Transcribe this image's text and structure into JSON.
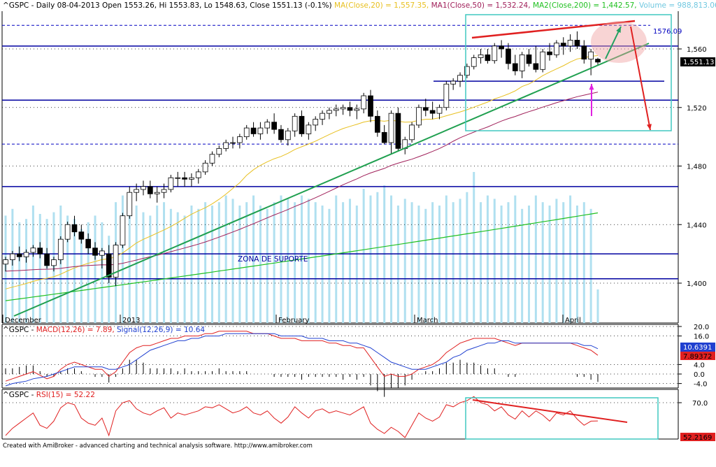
{
  "header": {
    "main_prefix": "^GSPC - Daily 08-04-2013 Open 1553.26, Hi 1553.83, Lo 1548.63, Close 1551.13 (-0.1%)",
    "ma20": "MA(Close,20) = 1,557.35,",
    "ma50": "MA1(Close,50) = 1,532.24,",
    "ma200": "MA2(Close,200) = 1,442.57,",
    "volume": "Volume = 988,813.06",
    "macd_prefix": "^GSPC - ",
    "macd_label": "MACD(12,26) = 7.89,",
    "signal_label": "Signal(12,26,9) = 10.64",
    "rsi_prefix": "^GSPC - ",
    "rsi_label": "RSI(15) = 52.22"
  },
  "annotations": {
    "support_zone": "ZONA DE SUPORTE",
    "level_1576": "1576.09",
    "last_close_tag": "1,551.13",
    "macd_tag": "10.6391",
    "signal_tag": "7.89372",
    "rsi_tag": "52.2169"
  },
  "footer": "Created with AmiBroker - advanced charting and technical analysis software. http://www.amibroker.com",
  "colors": {
    "ma20": "#e8c020",
    "ma50": "#a0205a",
    "ma200": "#20c020",
    "trendline": "#20a050",
    "resistance": "#e02020",
    "hlines": "#0000a0",
    "volume": "#b0e0f0",
    "macd": "#e02020",
    "signal": "#2040d0",
    "rsi": "#e02020",
    "box": "#40c8c0"
  },
  "chart_data": [
    {
      "type": "candlestick",
      "x_labels": [
        "December",
        "2013",
        "February",
        "March",
        "April"
      ],
      "y_ticks": [
        1400,
        1440,
        1480,
        1520,
        1560
      ],
      "y_tick_labels": [
        "1,400",
        "1,440",
        "1,480",
        "1,520",
        "1,560"
      ],
      "ylim": [
        1380,
        1591
      ],
      "horizontal_levels": [
        1576.09,
        1562,
        1538,
        1525,
        1495,
        1466,
        1420,
        1403
      ],
      "candles": [
        [
          1413,
          1418,
          1408,
          1416
        ],
        [
          1416,
          1422,
          1412,
          1420
        ],
        [
          1420,
          1425,
          1415,
          1418
        ],
        [
          1418,
          1423,
          1414,
          1421
        ],
        [
          1421,
          1426,
          1418,
          1424
        ],
        [
          1424,
          1428,
          1417,
          1420
        ],
        [
          1420,
          1424,
          1410,
          1412
        ],
        [
          1412,
          1418,
          1408,
          1416
        ],
        [
          1416,
          1432,
          1413,
          1430
        ],
        [
          1430,
          1442,
          1428,
          1440
        ],
        [
          1440,
          1446,
          1432,
          1435
        ],
        [
          1435,
          1440,
          1427,
          1430
        ],
        [
          1430,
          1434,
          1420,
          1424
        ],
        [
          1424,
          1428,
          1416,
          1419
        ],
        [
          1419,
          1424,
          1410,
          1422
        ],
        [
          1420,
          1426,
          1400,
          1404
        ],
        [
          1404,
          1428,
          1398,
          1426
        ],
        [
          1426,
          1448,
          1424,
          1446
        ],
        [
          1446,
          1466,
          1444,
          1462
        ],
        [
          1462,
          1468,
          1456,
          1464
        ],
        [
          1464,
          1470,
          1460,
          1466
        ],
        [
          1466,
          1470,
          1458,
          1461
        ],
        [
          1461,
          1466,
          1455,
          1462
        ],
        [
          1462,
          1468,
          1458,
          1464
        ],
        [
          1464,
          1474,
          1462,
          1472
        ],
        [
          1472,
          1476,
          1466,
          1472
        ],
        [
          1472,
          1476,
          1466,
          1471
        ],
        [
          1471,
          1475,
          1466,
          1472
        ],
        [
          1472,
          1478,
          1468,
          1476
        ],
        [
          1476,
          1484,
          1474,
          1482
        ],
        [
          1482,
          1490,
          1480,
          1488
        ],
        [
          1488,
          1494,
          1486,
          1492
        ],
        [
          1492,
          1498,
          1490,
          1496
        ],
        [
          1496,
          1500,
          1492,
          1496
        ],
        [
          1496,
          1502,
          1492,
          1500
        ],
        [
          1500,
          1508,
          1498,
          1506
        ],
        [
          1506,
          1510,
          1500,
          1502
        ],
        [
          1502,
          1510,
          1498,
          1506
        ],
        [
          1506,
          1512,
          1502,
          1510
        ],
        [
          1510,
          1516,
          1502,
          1505
        ],
        [
          1505,
          1508,
          1496,
          1498
        ],
        [
          1498,
          1506,
          1494,
          1504
        ],
        [
          1504,
          1516,
          1500,
          1514
        ],
        [
          1514,
          1518,
          1500,
          1502
        ],
        [
          1502,
          1510,
          1498,
          1508
        ],
        [
          1508,
          1514,
          1504,
          1512
        ],
        [
          1512,
          1518,
          1508,
          1516
        ],
        [
          1516,
          1520,
          1512,
          1518
        ],
        [
          1518,
          1522,
          1514,
          1519
        ],
        [
          1519,
          1522,
          1515,
          1520
        ],
        [
          1520,
          1524,
          1514,
          1518
        ],
        [
          1518,
          1522,
          1512,
          1519
        ],
        [
          1519,
          1530,
          1516,
          1528
        ],
        [
          1528,
          1532,
          1510,
          1514
        ],
        [
          1514,
          1518,
          1500,
          1503
        ],
        [
          1503,
          1508,
          1495,
          1496
        ],
        [
          1496,
          1518,
          1488,
          1516
        ],
        [
          1516,
          1520,
          1490,
          1492
        ],
        [
          1492,
          1500,
          1488,
          1498
        ],
        [
          1498,
          1510,
          1496,
          1508
        ],
        [
          1508,
          1522,
          1506,
          1520
        ],
        [
          1520,
          1526,
          1514,
          1518
        ],
        [
          1518,
          1524,
          1512,
          1516
        ],
        [
          1516,
          1522,
          1512,
          1520
        ],
        [
          1520,
          1538,
          1518,
          1536
        ],
        [
          1536,
          1540,
          1532,
          1538
        ],
        [
          1538,
          1544,
          1534,
          1542
        ],
        [
          1542,
          1550,
          1540,
          1548
        ],
        [
          1548,
          1556,
          1546,
          1554
        ],
        [
          1554,
          1560,
          1550,
          1556
        ],
        [
          1556,
          1560,
          1550,
          1552
        ],
        [
          1552,
          1564,
          1550,
          1562
        ],
        [
          1562,
          1566,
          1554,
          1560
        ],
        [
          1560,
          1564,
          1546,
          1550
        ],
        [
          1550,
          1556,
          1542,
          1545
        ],
        [
          1545,
          1558,
          1540,
          1556
        ],
        [
          1556,
          1560,
          1548,
          1550
        ],
        [
          1550,
          1562,
          1544,
          1546
        ],
        [
          1546,
          1560,
          1544,
          1558
        ],
        [
          1558,
          1564,
          1552,
          1556
        ],
        [
          1556,
          1566,
          1554,
          1564
        ],
        [
          1564,
          1568,
          1556,
          1562
        ],
        [
          1562,
          1570,
          1558,
          1566
        ],
        [
          1566,
          1572,
          1560,
          1562
        ],
        [
          1562,
          1566,
          1550,
          1553
        ],
        [
          1553,
          1560,
          1542,
          1558
        ],
        [
          1553,
          1554,
          1549,
          1551
        ]
      ],
      "volume": [
        640,
        680,
        600,
        620,
        700,
        650,
        620,
        660,
        700,
        640,
        620,
        560,
        600,
        640,
        600,
        520,
        720,
        760,
        680,
        700,
        660,
        640,
        700,
        720,
        680,
        660,
        640,
        700,
        680,
        720,
        700,
        720,
        760,
        740,
        700,
        720,
        760,
        700,
        680,
        720,
        760,
        740,
        720,
        760,
        740,
        720,
        700,
        680,
        760,
        720,
        740,
        700,
        800,
        760,
        780,
        820,
        760,
        700,
        740,
        720,
        700,
        680,
        720,
        700,
        760,
        720,
        740,
        780,
        900,
        720,
        760,
        740,
        700,
        720,
        760,
        680,
        700,
        760,
        720,
        700,
        740,
        720,
        760,
        700,
        720,
        680,
        200
      ],
      "macd": [
        -3,
        -2,
        -1,
        0,
        1,
        -0.5,
        -2,
        -1,
        2,
        4,
        5,
        4,
        3,
        2,
        2,
        -1,
        1,
        5,
        9,
        11,
        12,
        12,
        13,
        14,
        15,
        15,
        16,
        16,
        16,
        17,
        17,
        18,
        18,
        18,
        18,
        18,
        17,
        17,
        17,
        16,
        15,
        15,
        15,
        14,
        14,
        14,
        14,
        13,
        13,
        12,
        12,
        11,
        11,
        7,
        3,
        -1,
        0,
        -1,
        -1,
        0,
        2,
        3,
        4,
        6,
        9,
        11,
        13,
        14,
        15,
        15,
        15,
        15,
        14,
        13,
        12,
        13,
        13,
        13,
        13,
        13,
        13,
        13,
        13,
        12,
        11,
        10,
        7.89
      ],
      "signal": [
        -5,
        -4,
        -3.5,
        -3,
        -2,
        -1.5,
        -1,
        0,
        1,
        2,
        3,
        3,
        3,
        3,
        3,
        2,
        2,
        3,
        4,
        6,
        8,
        10,
        11,
        12,
        13,
        14,
        14,
        15,
        15,
        16,
        16,
        16,
        17,
        17,
        17,
        17,
        17,
        17,
        17,
        17,
        16,
        16,
        16,
        16,
        15,
        15,
        15,
        14,
        14,
        14,
        13,
        13,
        12,
        11,
        9,
        7,
        5,
        4,
        3,
        2,
        2,
        2,
        3,
        4,
        5,
        7,
        8,
        10,
        11,
        12,
        13,
        13,
        14,
        14,
        13,
        13,
        13,
        13,
        13,
        13,
        13,
        13,
        13,
        13,
        12,
        12,
        10.64
      ],
      "rsi": [
        38,
        45,
        50,
        55,
        60,
        48,
        45,
        52,
        65,
        70,
        68,
        55,
        50,
        48,
        55,
        38,
        62,
        70,
        72,
        64,
        60,
        58,
        62,
        65,
        55,
        60,
        58,
        60,
        62,
        66,
        65,
        68,
        64,
        60,
        62,
        66,
        60,
        58,
        62,
        55,
        50,
        56,
        66,
        60,
        55,
        62,
        64,
        60,
        62,
        60,
        58,
        62,
        66,
        50,
        44,
        40,
        46,
        42,
        36,
        48,
        60,
        55,
        52,
        56,
        68,
        66,
        70,
        72,
        76,
        70,
        68,
        62,
        66,
        58,
        54,
        62,
        56,
        62,
        58,
        52,
        60,
        58,
        62,
        54,
        48,
        52,
        52.22
      ],
      "rsi_ticks": [
        "70.0"
      ],
      "macd_ticks": [
        "20.0",
        "16.0",
        "4.0",
        "0.0",
        "-4.0"
      ]
    }
  ]
}
